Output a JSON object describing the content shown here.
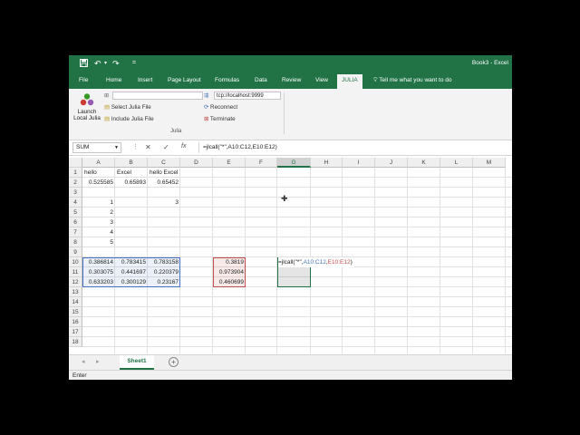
{
  "window": {
    "title": "Book3 - Excel"
  },
  "colors": {
    "excel_green": "#217346",
    "blue_ref": "#4472c4",
    "red_ref": "#c0504d",
    "ribbon_bg": "#f3f3f3"
  },
  "quick_access": {
    "save_icon": "save-icon",
    "undo_icon": "undo-icon",
    "redo_icon": "redo-icon",
    "customize": "="
  },
  "ribbon_tabs": [
    "File",
    "Home",
    "Insert",
    "Page Layout",
    "Formulas",
    "Data",
    "Review",
    "View",
    "JULIA"
  ],
  "active_tab": "JULIA",
  "tell_me": "Tell me what you want to do",
  "julia_ribbon": {
    "launch_label_1": "Launch",
    "launch_label_2": "Local Julia",
    "select_file": "Select Julia File",
    "include_file": "Include Julia File",
    "host": "tcp://localhost:9999",
    "reconnect": "Reconnect",
    "terminate": "Terminate",
    "group_label": "Julia"
  },
  "formula_bar": {
    "name_box": "SUM",
    "cancel": "✕",
    "enter": "✓",
    "fx": "fx",
    "formula": "=jlcall(\"*\",A10:C12,E10:E12)"
  },
  "columns": [
    "A",
    "B",
    "C",
    "D",
    "E",
    "F",
    "G",
    "H",
    "I",
    "J",
    "K",
    "L",
    "M"
  ],
  "selected_column": "G",
  "rows": [
    "1",
    "2",
    "3",
    "4",
    "5",
    "6",
    "7",
    "8",
    "9",
    "10",
    "11",
    "12",
    "13",
    "14",
    "15",
    "16",
    "17",
    "18"
  ],
  "cells": {
    "A1": "hello",
    "B1": "Excel",
    "C1": "hello Excel",
    "A2": "0.525585",
    "B2": "0.65893",
    "C2": "0.65452",
    "A4": "1",
    "C4": "3",
    "A5": "2",
    "A6": "3",
    "A7": "4",
    "A8": "5",
    "A10": "0.386814",
    "B10": "0.783415",
    "C10": "0.783158",
    "E10": "0.3819",
    "A11": "0.303075",
    "B11": "0.441697",
    "C11": "0.220379",
    "E11": "0.973904",
    "A12": "0.633203",
    "B12": "0.300129",
    "C12": "0.23167",
    "E12": "0.460699"
  },
  "edit_cell": {
    "prefix": "=jlcall(\"*\",",
    "ref1": "A10:C12",
    "comma": ",",
    "ref2": "E10:E12",
    "suffix": ")"
  },
  "sheets": [
    "Sheet1"
  ],
  "status": "Enter"
}
